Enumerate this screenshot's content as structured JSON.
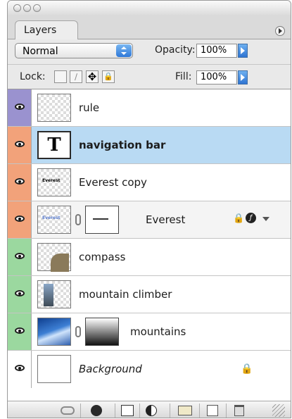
{
  "panel": {
    "tab_label": "Layers",
    "blend_mode": "Normal",
    "opacity_label": "Opacity:",
    "opacity_value": "100%",
    "lock_label": "Lock:",
    "fill_label": "Fill:",
    "fill_value": "100%"
  },
  "layers": [
    {
      "name": "rule",
      "eye_color": "#9a92cf",
      "thumb": "checker"
    },
    {
      "name": "navigation bar",
      "eye_color": "#f2a27a",
      "thumb": "text",
      "thumb_text": "T",
      "selected": true
    },
    {
      "name": "Everest copy",
      "eye_color": "#f2a27a",
      "thumb": "checker",
      "thumb_text": "Everest"
    },
    {
      "name": "Everest",
      "eye_color": "#f2a27a",
      "thumb": "checker",
      "thumb_text": "Everest",
      "has_mask": true
    },
    {
      "name": "compass",
      "eye_color": "#9bd89f",
      "thumb": "checker"
    },
    {
      "name": "mountain climber",
      "eye_color": "#9bd89f",
      "thumb": "checker"
    },
    {
      "name": "mountains",
      "eye_color": "#9bd89f",
      "thumb": "photo",
      "has_mask": true
    },
    {
      "name": "Background",
      "eye_color": "#ffffff",
      "thumb": "white",
      "locked": true
    }
  ],
  "footer": {
    "icons": [
      "link-layers-icon",
      "layer-style-icon",
      "add-mask-icon",
      "adjustment-layer-icon",
      "new-group-icon",
      "new-layer-icon",
      "trash-icon"
    ]
  }
}
